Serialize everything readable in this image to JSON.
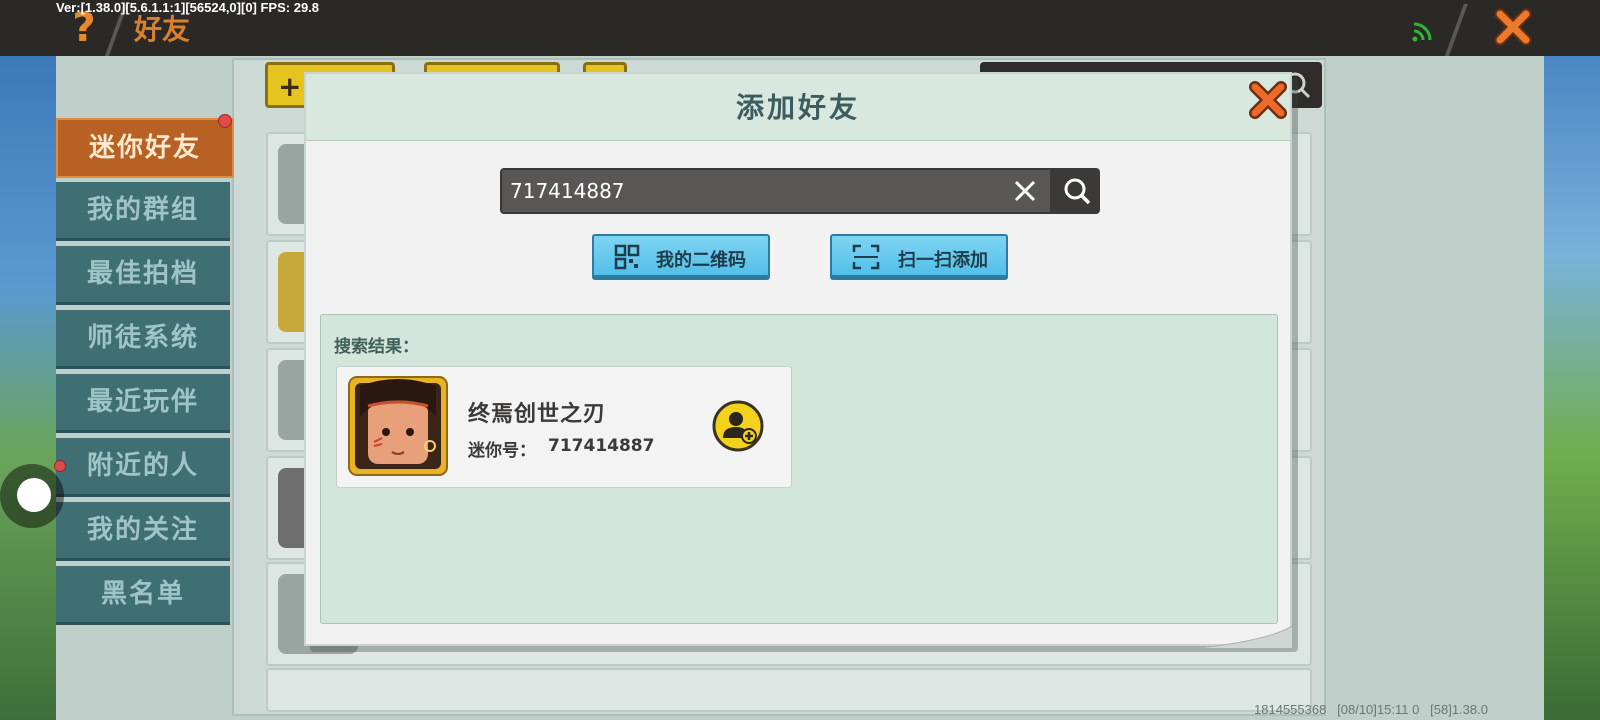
{
  "debug": {
    "text": "Ver:[1.38.0][5.6.1.1:1][56524,0][0] FPS: 29.8"
  },
  "header": {
    "title": "好友",
    "help_icon": "question-mark-icon",
    "wifi_icon": "wifi-icon",
    "close_icon": "close-icon"
  },
  "sidebar": {
    "items": [
      {
        "label": "迷你好友",
        "active": true,
        "badge": true
      },
      {
        "label": "我的群组"
      },
      {
        "label": "最佳拍档"
      },
      {
        "label": "师徒系统"
      },
      {
        "label": "最近玩伴"
      },
      {
        "label": "附近的人",
        "badge": true
      },
      {
        "label": "我的关注"
      },
      {
        "label": "黑名单"
      }
    ]
  },
  "dialog": {
    "title": "添加好友",
    "search": {
      "value": "717414887"
    },
    "qr_button": {
      "label": "我的二维码",
      "icon": "qr-code-icon"
    },
    "scan_button": {
      "label": "扫一扫添加",
      "icon": "scan-icon"
    },
    "results_label": "搜索结果：",
    "result": {
      "name": "终焉创世之刃",
      "id_label": "迷你号：",
      "id_value": "717414887",
      "add_icon": "add-friend-icon"
    }
  },
  "footer": {
    "text": "1814555368   [08/10]15:11 0   [58]1.38.0"
  },
  "colors": {
    "accent_orange": "#d8802d",
    "sidebar_teal": "#3f6e75",
    "active_tab": "#b76224",
    "button_blue": "#52bfe8",
    "badge_red": "#e14a48"
  }
}
